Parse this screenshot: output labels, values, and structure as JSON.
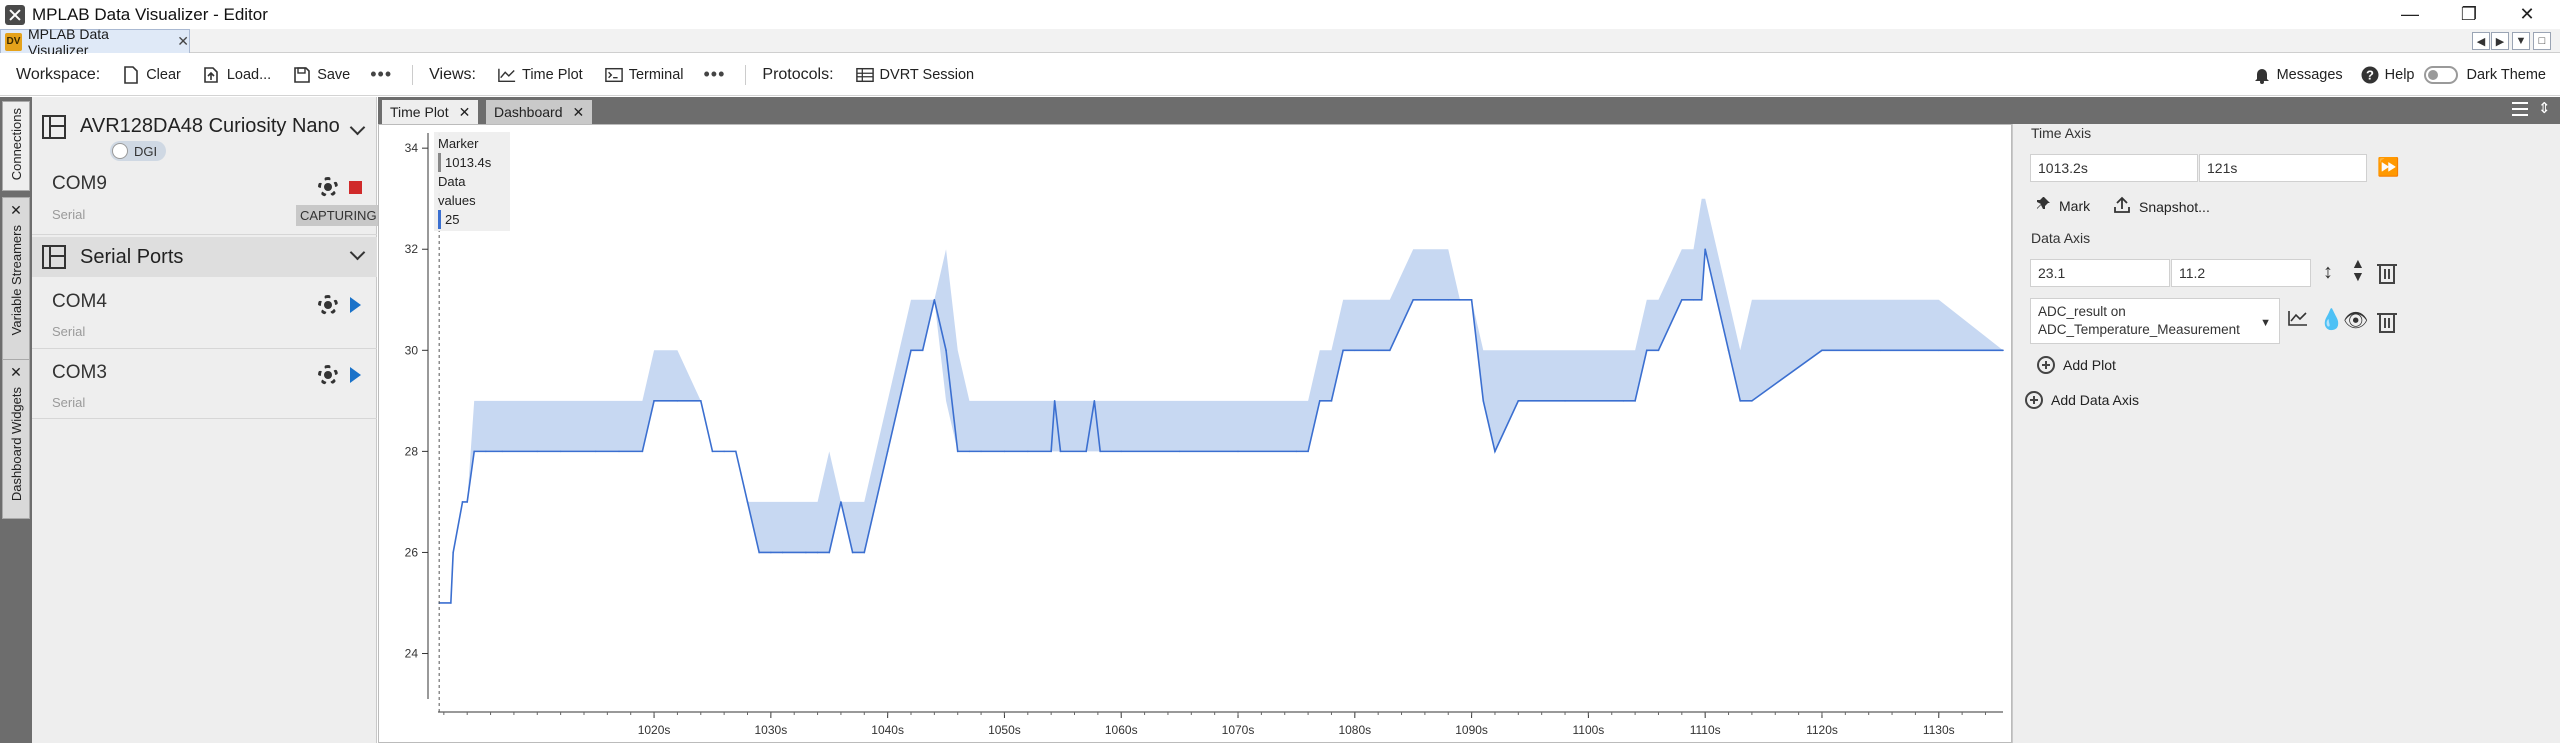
{
  "window": {
    "title": "MPLAB Data Visualizer - Editor",
    "editor_tab": "MPLAB Data Visualizer",
    "editor_tab_icon": "DV"
  },
  "toolbar": {
    "workspace_label": "Workspace:",
    "clear": "Clear",
    "load": "Load...",
    "save": "Save",
    "more": "•••",
    "views_label": "Views:",
    "time_plot": "Time Plot",
    "terminal": "Terminal",
    "protocols_label": "Protocols:",
    "dvrt_session": "DVRT Session",
    "messages": "Messages",
    "help": "Help",
    "dark_theme": "Dark Theme"
  },
  "vertical_tabs": [
    "Connections",
    "Variable Streamers",
    "Dashboard Widgets"
  ],
  "connections": {
    "device": {
      "name": "AVR128DA48 Curiosity Nano",
      "dgi_label": "DGI"
    },
    "com9": {
      "name": "COM9",
      "type": "Serial",
      "status": "CAPTURING"
    },
    "serial_ports_label": "Serial Ports",
    "com4": {
      "name": "COM4",
      "type": "Serial"
    },
    "com3": {
      "name": "COM3",
      "type": "Serial"
    }
  },
  "plot_tabs": [
    {
      "label": "Time Plot",
      "active": true
    },
    {
      "label": "Dashboard",
      "active": false
    }
  ],
  "tooltip": {
    "marker_label": "Marker",
    "marker_value": "1013.4s",
    "data_label": "Data values",
    "data_value": "25"
  },
  "chart_data": {
    "type": "line",
    "title": "",
    "xlabel": "",
    "ylabel": "",
    "xlim": [
      1001.5,
      1135.5
    ],
    "ylim": [
      23.1,
      34.3
    ],
    "x_ticks": [
      1020,
      1030,
      1040,
      1050,
      1060,
      1070,
      1080,
      1090,
      1100,
      1110,
      1120,
      1130
    ],
    "x_tick_suffix": "s",
    "y_ticks": [
      24,
      26,
      28,
      30,
      32,
      34
    ],
    "marker_x": 1001.6,
    "series": [
      {
        "color": "#3b6fd0",
        "band_color": "#c7d8f2",
        "x": [
          1001.6,
          1002.6,
          1002.8,
          1003.6,
          1004.0,
          1004.6,
          1005.6,
          1007,
          1010,
          1012,
          1015,
          1017,
          1019,
          1020,
          1022,
          1024,
          1025,
          1026,
          1027,
          1028,
          1029,
          1030,
          1031,
          1033,
          1034,
          1035,
          1036,
          1037,
          1038,
          1039,
          1040,
          1041,
          1042,
          1043,
          1044,
          1045,
          1046,
          1047,
          1048,
          1050,
          1052,
          1054,
          1054.3,
          1054.8,
          1057,
          1057.7,
          1058.2,
          1060,
          1065,
          1070,
          1075,
          1076,
          1077,
          1078,
          1079,
          1080,
          1082,
          1083,
          1085,
          1088,
          1089,
          1090,
          1091,
          1092,
          1094,
          1098,
          1103,
          1104,
          1105,
          1106,
          1108,
          1109,
          1109.7,
          1110,
          1111,
          1112,
          1113,
          1114,
          1120,
          1125,
          1130,
          1135.5
        ],
        "min": [
          25,
          25,
          26,
          27,
          27,
          28,
          28,
          28,
          28,
          28,
          28,
          28,
          28,
          29,
          29,
          29,
          28,
          28,
          28,
          27,
          26,
          26,
          26,
          26,
          26,
          26,
          27,
          26,
          26,
          27,
          28,
          29,
          30,
          30,
          31,
          29,
          28,
          28,
          28,
          28,
          28,
          28,
          28,
          28,
          28,
          28,
          28,
          28,
          28,
          28,
          28,
          28,
          29,
          29,
          30,
          30,
          30,
          30,
          31,
          31,
          31,
          31,
          29,
          28,
          29,
          29,
          29,
          29,
          30,
          30,
          31,
          31,
          31,
          32,
          31,
          30,
          29,
          29,
          30,
          30,
          30,
          30
        ],
        "max": [
          25,
          25,
          26,
          27,
          27,
          29,
          29,
          29,
          29,
          29,
          29,
          29,
          29,
          30,
          30,
          29,
          28,
          28,
          28,
          27,
          27,
          27,
          27,
          27,
          27,
          28,
          27,
          27,
          27,
          28,
          29,
          30,
          31,
          31,
          31,
          32,
          30,
          29,
          29,
          29,
          29,
          29,
          29,
          29,
          29,
          29,
          29,
          29,
          29,
          29,
          29,
          29,
          30,
          30,
          31,
          31,
          31,
          31,
          32,
          32,
          31,
          31,
          30,
          30,
          30,
          30,
          30,
          30,
          31,
          31,
          32,
          32,
          33,
          33,
          32,
          31,
          30,
          31,
          31,
          31,
          31,
          30
        ],
        "y": [
          25,
          25,
          26,
          27,
          27,
          28,
          28,
          28,
          28,
          28,
          28,
          28,
          28,
          29,
          29,
          29,
          28,
          28,
          28,
          27,
          26,
          26,
          26,
          26,
          26,
          26,
          27,
          26,
          26,
          27,
          28,
          29,
          30,
          30,
          31,
          30,
          28,
          28,
          28,
          28,
          28,
          28,
          29,
          28,
          28,
          29,
          28,
          28,
          28,
          28,
          28,
          28,
          29,
          29,
          30,
          30,
          30,
          30,
          31,
          31,
          31,
          31,
          29,
          28,
          29,
          29,
          29,
          29,
          30,
          30,
          31,
          31,
          31,
          32,
          31,
          30,
          29,
          29,
          30,
          30,
          30,
          30
        ]
      }
    ]
  },
  "controls": {
    "time_axis_label": "Time Axis",
    "time_start": "1013.2s",
    "time_span": "121s",
    "mark_label": "Mark",
    "snapshot_label": "Snapshot...",
    "data_axis_label": "Data Axis",
    "data_center": "23.1",
    "data_range": "11.2",
    "plot_source_line1": "ADC_result on",
    "plot_source_line2": "ADC_Temperature_Measurement",
    "add_plot": "Add Plot",
    "add_data_axis": "Add Data Axis"
  },
  "colors": {
    "accent": "#1a72c9",
    "stop_red": "#d02a2a",
    "series_line": "#3b6fd0",
    "series_band": "#c7d8f2"
  }
}
